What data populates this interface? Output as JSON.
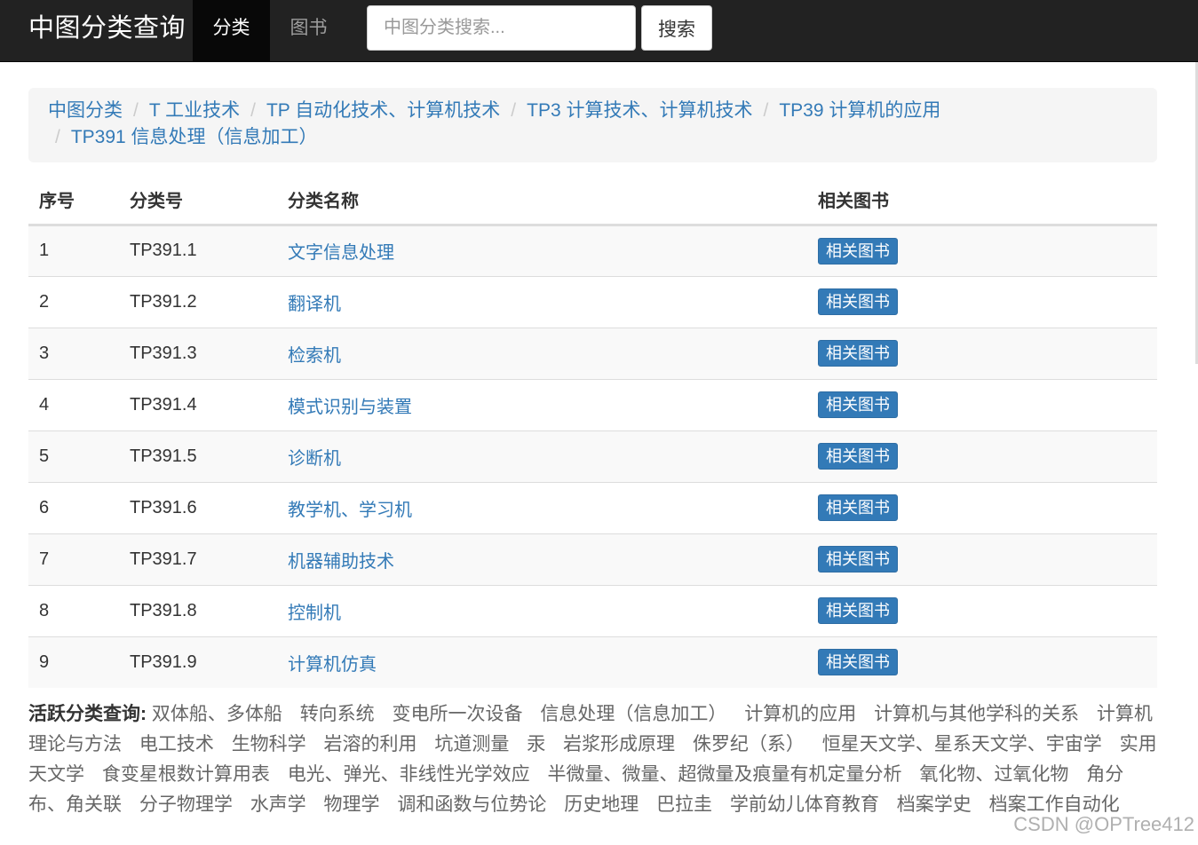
{
  "navbar": {
    "brand": "中图分类查询",
    "tab_active": "分类",
    "tab_books": "图书",
    "search_placeholder": "中图分类搜索...",
    "search_button": "搜索"
  },
  "breadcrumb": [
    "中图分类",
    "T 工业技术",
    "TP 自动化技术、计算机技术",
    "TP3 计算技术、计算机技术",
    "TP39 计算机的应用",
    "TP391 信息处理（信息加工）"
  ],
  "table": {
    "headers": [
      "序号",
      "分类号",
      "分类名称",
      "相关图书"
    ],
    "rows": [
      {
        "idx": "1",
        "code": "TP391.1",
        "name": "文字信息处理",
        "btn": "相关图书"
      },
      {
        "idx": "2",
        "code": "TP391.2",
        "name": "翻译机",
        "btn": "相关图书"
      },
      {
        "idx": "3",
        "code": "TP391.3",
        "name": "检索机",
        "btn": "相关图书"
      },
      {
        "idx": "4",
        "code": "TP391.4",
        "name": "模式识别与装置",
        "btn": "相关图书"
      },
      {
        "idx": "5",
        "code": "TP391.5",
        "name": "诊断机",
        "btn": "相关图书"
      },
      {
        "idx": "6",
        "code": "TP391.6",
        "name": "教学机、学习机",
        "btn": "相关图书"
      },
      {
        "idx": "7",
        "code": "TP391.7",
        "name": "机器辅助技术",
        "btn": "相关图书"
      },
      {
        "idx": "8",
        "code": "TP391.8",
        "name": "控制机",
        "btn": "相关图书"
      },
      {
        "idx": "9",
        "code": "TP391.9",
        "name": "计算机仿真",
        "btn": "相关图书"
      }
    ]
  },
  "active": {
    "label": "活跃分类查询:",
    "tags": [
      "双体船、多体船",
      "转向系统",
      "变电所一次设备",
      "信息处理（信息加工）",
      "计算机的应用",
      "计算机与其他学科的关系",
      "计算机理论与方法",
      "电工技术",
      "生物科学",
      "岩溶的利用",
      "坑道测量",
      "汞",
      "岩浆形成原理",
      "侏罗纪（系）",
      "恒星天文学、星系天文学、宇宙学",
      "实用天文学",
      "食变星根数计算用表",
      "电光、弹光、非线性光学效应",
      "半微量、微量、超微量及痕量有机定量分析",
      "氧化物、过氧化物",
      "角分布、角关联",
      "分子物理学",
      "水声学",
      "物理学",
      "调和函数与位势论",
      "历史地理",
      "巴拉圭",
      "学前幼儿体育教育",
      "档案学史",
      "档案工作自动化"
    ]
  },
  "watermark": "CSDN @OPTree412",
  "colors": {
    "navbar": "#222222",
    "link": "#337ab7",
    "button": "#337ab7"
  }
}
